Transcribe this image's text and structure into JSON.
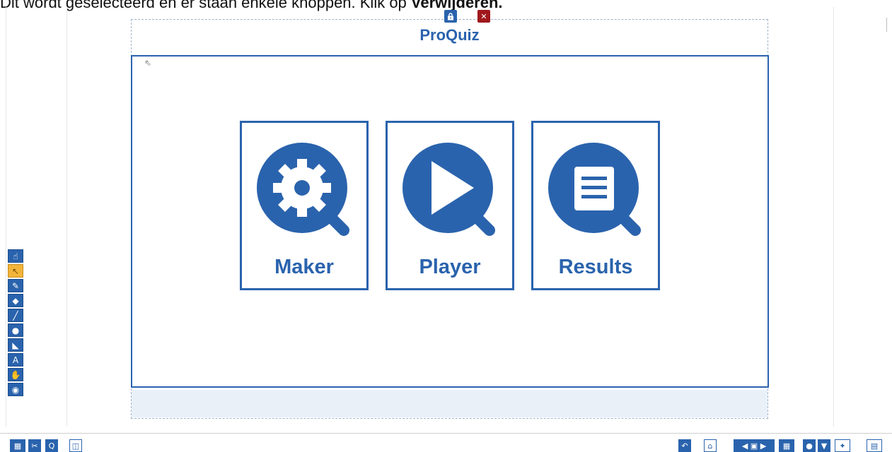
{
  "caption": {
    "text": "Dit wordt geselecteerd en er staan enkele knoppen. Klik op ",
    "emphasis": "Verwijderen."
  },
  "widget": {
    "title": "ProQuiz",
    "lock_icon": "lock-icon",
    "close_icon": "close-icon"
  },
  "tiles": [
    {
      "label": "Maker",
      "icon": "gear-magnifier-icon"
    },
    {
      "label": "Player",
      "icon": "play-magnifier-icon"
    },
    {
      "label": "Results",
      "icon": "document-magnifier-icon"
    }
  ],
  "colors": {
    "accent": "#2a63ad",
    "close": "#a0181c",
    "active_tool": "#f2b53a",
    "footer_bar": "#e9f0f8"
  },
  "toolbox": [
    {
      "name": "select-hand-icon",
      "glyph": "☝"
    },
    {
      "name": "pointer-icon",
      "glyph": "↖",
      "active": true
    },
    {
      "name": "pen-icon",
      "glyph": "✎"
    },
    {
      "name": "eraser-icon",
      "glyph": "◆"
    },
    {
      "name": "line-icon",
      "glyph": "╱"
    },
    {
      "name": "circle-shape-icon",
      "glyph": "●"
    },
    {
      "name": "triangle-ruler-icon",
      "glyph": "◣"
    },
    {
      "name": "text-icon",
      "glyph": "A"
    },
    {
      "name": "pan-hand-icon",
      "glyph": "✋"
    },
    {
      "name": "target-icon",
      "glyph": "◉"
    }
  ],
  "bottom_left": [
    {
      "name": "gallery-icon",
      "glyph": "▦"
    },
    {
      "name": "tools-icon",
      "glyph": "✂"
    },
    {
      "name": "zoom-icon",
      "glyph": "Q"
    },
    {
      "name": "page-frame-icon",
      "glyph": "◫"
    }
  ],
  "bottom_right": [
    {
      "name": "undo-icon",
      "glyph": "↶"
    },
    {
      "name": "open-folder-icon",
      "glyph": "⌂"
    },
    {
      "name": "page-navigation-icon",
      "glyph": "◀ ▣ ▶"
    },
    {
      "name": "page-sorter-icon",
      "glyph": "▦"
    },
    {
      "name": "user-icon",
      "glyph": "●"
    },
    {
      "name": "presentation-icon",
      "glyph": "▼"
    },
    {
      "name": "screen-capture-icon",
      "glyph": "✦"
    },
    {
      "name": "page-view-icon",
      "glyph": "▤"
    }
  ]
}
